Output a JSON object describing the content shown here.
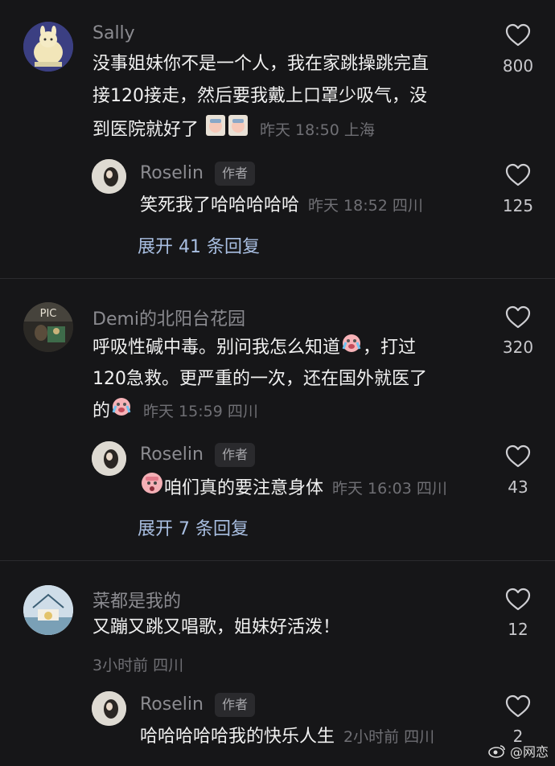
{
  "comments": [
    {
      "name": "Sally",
      "likes": "800",
      "text_lines": [
        "没事姐妹你不是一个人，我在家跳操跳完直",
        "接120接走，然后要我戴上口罩少吸气，没",
        "到医院就好了"
      ],
      "meta": "昨天 18:50 上海",
      "reply": {
        "name": "Roselin",
        "tag": "作者",
        "text": "笑死我了哈哈哈哈哈",
        "meta": "昨天 18:52 四川",
        "likes": "125"
      },
      "expand": "展开 41 条回复"
    },
    {
      "name": "Demi的北阳台花园",
      "likes": "320",
      "text_lines": [
        "呼吸性碱中毒。别问我怎么知道",
        "，打过",
        "120急救。更严重的一次，还在国外就医了",
        "的"
      ],
      "meta": "昨天 15:59 四川",
      "reply": {
        "name": "Roselin",
        "tag": "作者",
        "text": "咱们真的要注意身体",
        "meta": "昨天 16:03 四川",
        "likes": "43"
      },
      "expand": "展开 7 条回复"
    },
    {
      "name": "菜都是我的",
      "likes": "12",
      "text_lines": [
        "又蹦又跳又唱歌，姐妹好活泼！"
      ],
      "meta": "3小时前 四川",
      "reply": {
        "name": "Roselin",
        "tag": "作者",
        "text": "哈哈哈哈哈我的快乐人生",
        "meta": "2小时前 四川",
        "likes": "2"
      }
    }
  ],
  "avatar_labels": {
    "demi": "PIC"
  },
  "watermark": "@网恋",
  "colors": {
    "background": "#161618",
    "link": "#a9bfe2",
    "meta": "#6f6f74",
    "name": "#8b8b90"
  }
}
